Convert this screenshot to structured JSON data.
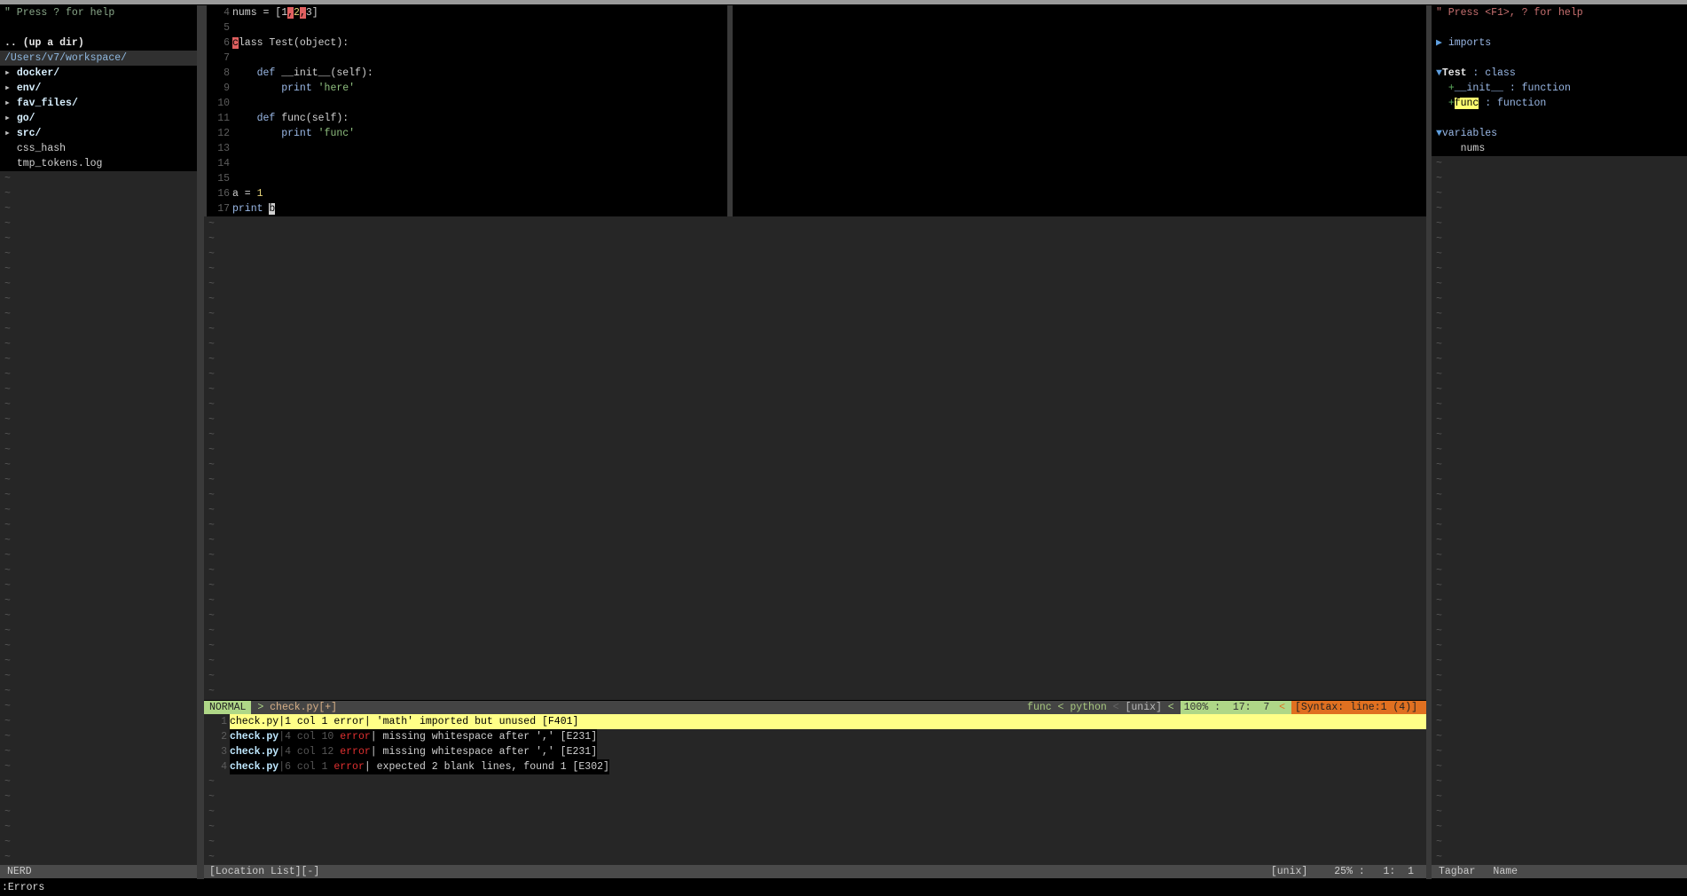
{
  "filler_char": "~",
  "nerdtree": {
    "help": "\" Press ? for help",
    "up_dir": ".. (up a dir)",
    "path": "/Users/v7/workspace/",
    "items": [
      {
        "arrow": "▸",
        "label": "docker/",
        "type": "dir"
      },
      {
        "arrow": "▸",
        "label": "env/",
        "type": "dir"
      },
      {
        "arrow": "▸",
        "label": "fav_files/",
        "type": "dir"
      },
      {
        "arrow": "▸",
        "label": "go/",
        "type": "dir"
      },
      {
        "arrow": "▸",
        "label": "src/",
        "type": "dir"
      },
      {
        "arrow": " ",
        "label": "css_hash",
        "type": "file"
      },
      {
        "arrow": " ",
        "label": "tmp_tokens.log",
        "type": "file"
      }
    ],
    "status": "NERD"
  },
  "editor": {
    "lines": [
      {
        "n": "4",
        "segs": [
          {
            "t": "nums = [1",
            "c": ""
          },
          {
            "t": ",",
            "c": "errhl"
          },
          {
            "t": "2",
            "c": "num"
          },
          {
            "t": ",",
            "c": "errhl"
          },
          {
            "t": "3]",
            "c": ""
          }
        ]
      },
      {
        "n": "5",
        "segs": []
      },
      {
        "n": "6",
        "segs": [
          {
            "t": "c",
            "c": "errhl"
          },
          {
            "t": "lass Test(object):",
            "c": ""
          }
        ]
      },
      {
        "n": "7",
        "segs": []
      },
      {
        "n": "8",
        "segs": [
          {
            "t": "    ",
            "c": ""
          },
          {
            "t": "def",
            "c": "kw"
          },
          {
            "t": " __init__(self):",
            "c": ""
          }
        ]
      },
      {
        "n": "9",
        "segs": [
          {
            "t": "        ",
            "c": ""
          },
          {
            "t": "print",
            "c": "kw"
          },
          {
            "t": " ",
            "c": ""
          },
          {
            "t": "'here'",
            "c": "str"
          }
        ]
      },
      {
        "n": "10",
        "segs": []
      },
      {
        "n": "11",
        "segs": [
          {
            "t": "    ",
            "c": ""
          },
          {
            "t": "def",
            "c": "kw"
          },
          {
            "t": " func(self):",
            "c": ""
          }
        ]
      },
      {
        "n": "12",
        "segs": [
          {
            "t": "        ",
            "c": ""
          },
          {
            "t": "print",
            "c": "kw"
          },
          {
            "t": " ",
            "c": ""
          },
          {
            "t": "'func'",
            "c": "str"
          }
        ]
      },
      {
        "n": "13",
        "segs": []
      },
      {
        "n": "14",
        "segs": []
      },
      {
        "n": "15",
        "segs": []
      },
      {
        "n": "16",
        "segs": [
          {
            "t": "a = ",
            "c": ""
          },
          {
            "t": "1",
            "c": "num"
          }
        ]
      },
      {
        "n": "17",
        "segs": [
          {
            "t": "print",
            "c": "kw"
          },
          {
            "t": " ",
            "c": ""
          },
          {
            "t": "b",
            "c": "cursor"
          }
        ]
      }
    ],
    "statusline": {
      "mode": "NORMAL",
      "sep1": " > ",
      "filename": "check.py[+]",
      "func": "func < python",
      "sep2": " < ",
      "format": "[unix]",
      "sep3": " < ",
      "position": "100% :  17:  7",
      "sep4": " < ",
      "syntax": "[Syntax: line:1 (4)]"
    }
  },
  "loclist": {
    "rows": [
      {
        "n": "1",
        "file": "check.py",
        "pos": "|1 col 1 ",
        "err": "error",
        "msg": "| 'math' imported but unused [F401]",
        "selected": true
      },
      {
        "n": "2",
        "file": "check.py",
        "pos": "|4 col 10 ",
        "err": "error",
        "msg": "| missing whitespace after ',' [E231]",
        "selected": false
      },
      {
        "n": "3",
        "file": "check.py",
        "pos": "|4 col 12 ",
        "err": "error",
        "msg": "| missing whitespace after ',' [E231]",
        "selected": false
      },
      {
        "n": "4",
        "file": "check.py",
        "pos": "|6 col 1 ",
        "err": "error",
        "msg": "| expected 2 blank lines, found 1 [E302]",
        "selected": false
      }
    ],
    "status": {
      "title": "[Location List][-]",
      "format": "[unix]",
      "position": "25% :   1:  1"
    }
  },
  "tagbar": {
    "help": "\" Press <F1>, ? for help",
    "imports": "imports",
    "class_name": "Test",
    "class_kind": " : class",
    "members": [
      {
        "name": "__init__",
        "kind": " : function",
        "highlight": false
      },
      {
        "name": "func",
        "kind": " : function",
        "highlight": true
      }
    ],
    "variables": "variables",
    "var_items": [
      "nums"
    ],
    "status": {
      "name": "Tagbar",
      "sort": "Name"
    }
  },
  "cmdline": ":Errors",
  "colors": {
    "mode_bg": "#afd787",
    "syntax_bg": "#e07020",
    "selected_row": "#ffff87",
    "error": "#e03030"
  }
}
